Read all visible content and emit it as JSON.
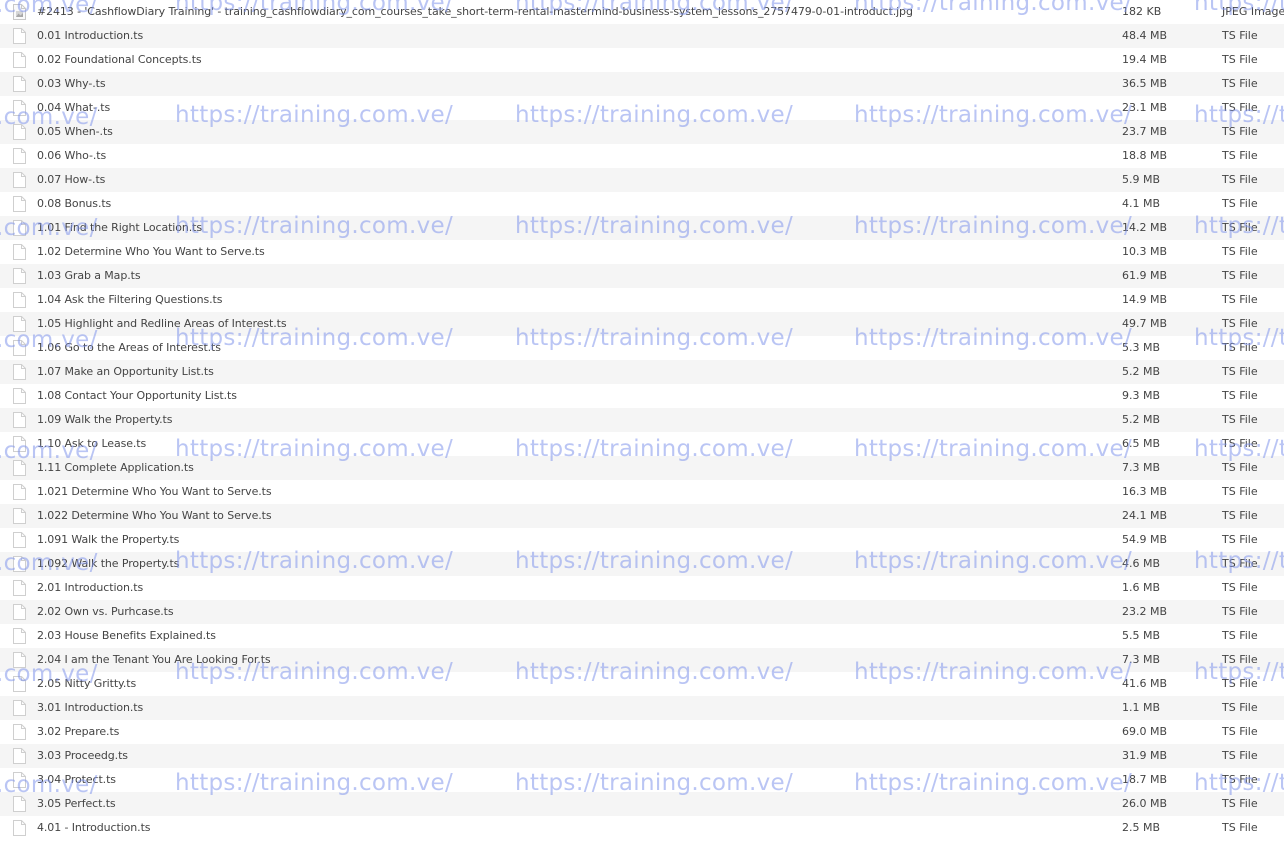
{
  "files": [
    {
      "name": "#2413 - 'CashflowDiary Training' - training_cashflowdiary_com_courses_take_short-term-rental-mastermind-business-system_lessons_2757479-0-01-introduct.jpg",
      "size": "182 KB",
      "type": "JPEG Image",
      "icon": "image-file-icon"
    },
    {
      "name": "0.01 Introduction.ts",
      "size": "48.4 MB",
      "type": "TS File",
      "icon": "file-icon"
    },
    {
      "name": "0.02 Foundational Concepts.ts",
      "size": "19.4 MB",
      "type": "TS File",
      "icon": "file-icon"
    },
    {
      "name": "0.03 Why-.ts",
      "size": "36.5 MB",
      "type": "TS File",
      "icon": "file-icon"
    },
    {
      "name": "0.04 What-.ts",
      "size": "23.1 MB",
      "type": "TS File",
      "icon": "file-icon"
    },
    {
      "name": "0.05 When-.ts",
      "size": "23.7 MB",
      "type": "TS File",
      "icon": "file-icon"
    },
    {
      "name": "0.06 Who-.ts",
      "size": "18.8 MB",
      "type": "TS File",
      "icon": "file-icon"
    },
    {
      "name": "0.07 How-.ts",
      "size": "5.9 MB",
      "type": "TS File",
      "icon": "file-icon"
    },
    {
      "name": "0.08 Bonus.ts",
      "size": "4.1 MB",
      "type": "TS File",
      "icon": "file-icon"
    },
    {
      "name": "1.01 Find the Right Location.ts",
      "size": "14.2 MB",
      "type": "TS File",
      "icon": "file-icon"
    },
    {
      "name": "1.02 Determine Who You Want to Serve.ts",
      "size": "10.3 MB",
      "type": "TS File",
      "icon": "file-icon"
    },
    {
      "name": "1.03 Grab a Map.ts",
      "size": "61.9 MB",
      "type": "TS File",
      "icon": "file-icon"
    },
    {
      "name": "1.04 Ask the Filtering Questions.ts",
      "size": "14.9 MB",
      "type": "TS File",
      "icon": "file-icon"
    },
    {
      "name": "1.05 Highlight and Redline Areas of Interest.ts",
      "size": "49.7 MB",
      "type": "TS File",
      "icon": "file-icon"
    },
    {
      "name": "1.06 Go to the Areas of Interest.ts",
      "size": "5.3 MB",
      "type": "TS File",
      "icon": "file-icon"
    },
    {
      "name": "1.07 Make an Opportunity List.ts",
      "size": "5.2 MB",
      "type": "TS File",
      "icon": "file-icon"
    },
    {
      "name": "1.08 Contact Your Opportunity List.ts",
      "size": "9.3 MB",
      "type": "TS File",
      "icon": "file-icon"
    },
    {
      "name": "1.09 Walk the Property.ts",
      "size": "5.2 MB",
      "type": "TS File",
      "icon": "file-icon"
    },
    {
      "name": "1.10 Ask to Lease.ts",
      "size": "6.5 MB",
      "type": "TS File",
      "icon": "file-icon"
    },
    {
      "name": "1.11 Complete Application.ts",
      "size": "7.3 MB",
      "type": "TS File",
      "icon": "file-icon"
    },
    {
      "name": "1.021 Determine Who You Want to Serve.ts",
      "size": "16.3 MB",
      "type": "TS File",
      "icon": "file-icon"
    },
    {
      "name": "1.022 Determine Who You Want to Serve.ts",
      "size": "24.1 MB",
      "type": "TS File",
      "icon": "file-icon"
    },
    {
      "name": "1.091 Walk the Property.ts",
      "size": "54.9 MB",
      "type": "TS File",
      "icon": "file-icon"
    },
    {
      "name": "1.092 Walk the Property.ts",
      "size": "4.6 MB",
      "type": "TS File",
      "icon": "file-icon"
    },
    {
      "name": "2.01 Introduction.ts",
      "size": "1.6 MB",
      "type": "TS File",
      "icon": "file-icon"
    },
    {
      "name": "2.02 Own vs. Purhcase.ts",
      "size": "23.2 MB",
      "type": "TS File",
      "icon": "file-icon"
    },
    {
      "name": "2.03 House Benefits Explained.ts",
      "size": "5.5 MB",
      "type": "TS File",
      "icon": "file-icon"
    },
    {
      "name": "2.04 I am the Tenant You Are Looking For.ts",
      "size": "7.3 MB",
      "type": "TS File",
      "icon": "file-icon"
    },
    {
      "name": "2.05 Nitty Gritty.ts",
      "size": "41.6 MB",
      "type": "TS File",
      "icon": "file-icon"
    },
    {
      "name": "3.01 Introduction.ts",
      "size": "1.1 MB",
      "type": "TS File",
      "icon": "file-icon"
    },
    {
      "name": "3.02 Prepare.ts",
      "size": "69.0 MB",
      "type": "TS File",
      "icon": "file-icon"
    },
    {
      "name": "3.03 Proceedg.ts",
      "size": "31.9 MB",
      "type": "TS File",
      "icon": "file-icon"
    },
    {
      "name": "3.04 Protect.ts",
      "size": "18.7 MB",
      "type": "TS File",
      "icon": "file-icon"
    },
    {
      "name": "3.05 Perfect.ts",
      "size": "26.0 MB",
      "type": "TS File",
      "icon": "file-icon"
    },
    {
      "name": "4.01 - Introduction.ts",
      "size": "2.5 MB",
      "type": "TS File",
      "icon": "file-icon"
    }
  ],
  "watermark": {
    "text": "https://training.com.ve/",
    "fragment": ".com.ve/",
    "color": "#8296eb"
  },
  "colors": {
    "row_alt": "#f5f5f5",
    "text": "#444444"
  }
}
